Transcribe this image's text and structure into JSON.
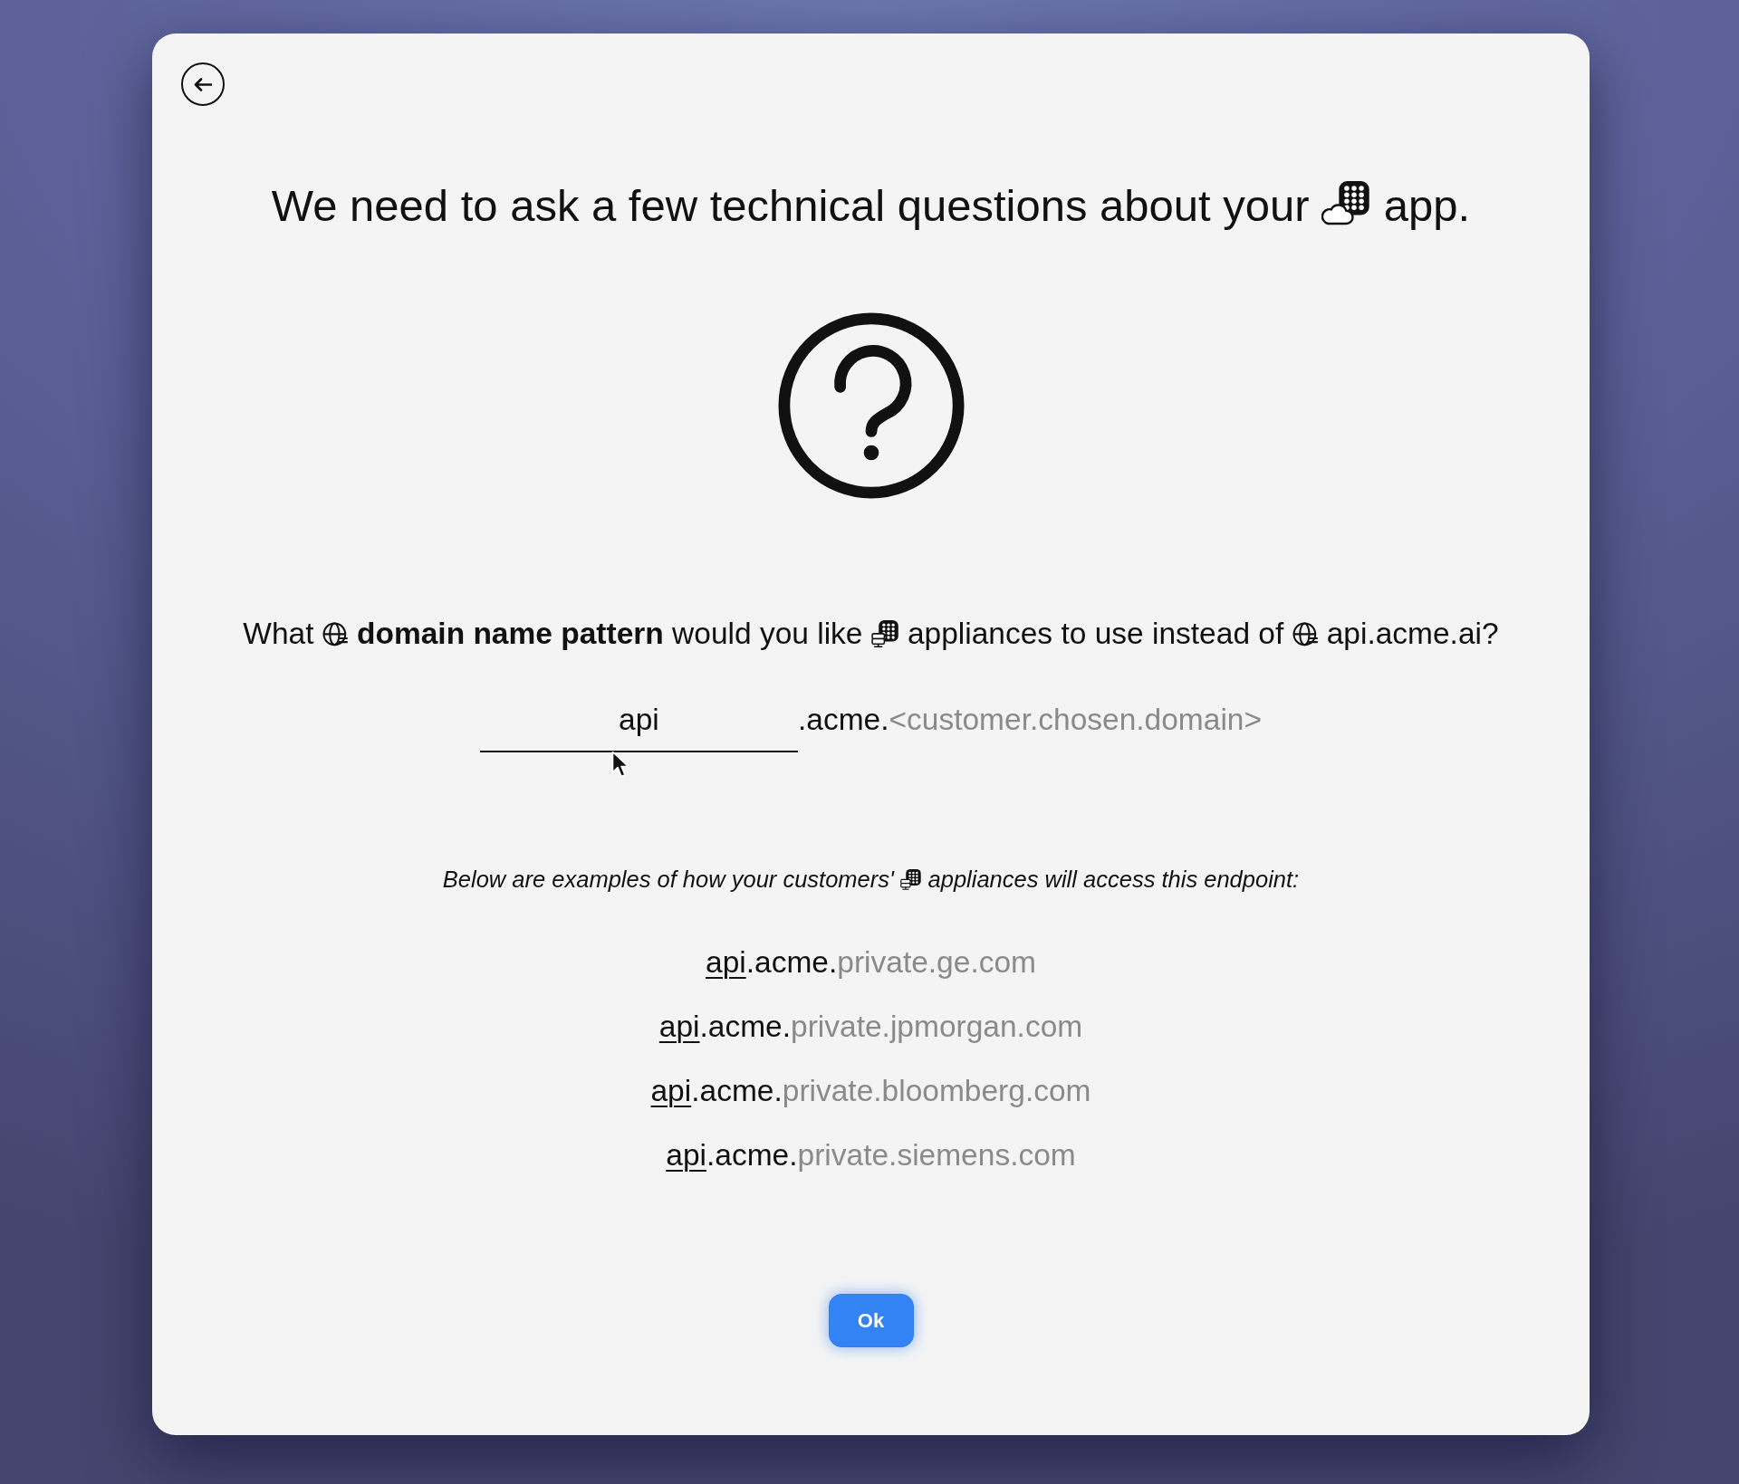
{
  "title": [
    {
      "kind": "text",
      "text": "We need to ask a few technical questions about your"
    },
    {
      "kind": "cloud-app"
    },
    {
      "kind": "text",
      "text": "app."
    }
  ],
  "question": [
    {
      "kind": "text",
      "text": "What"
    },
    {
      "kind": "globe"
    },
    {
      "kind": "text",
      "text": "**domain name pattern** would you like"
    },
    {
      "kind": "appliance"
    },
    {
      "kind": "text",
      "text": "appliances to use instead of"
    },
    {
      "kind": "globe"
    },
    {
      "kind": "text",
      "text": "api.acme.ai?"
    }
  ],
  "subdomain_field": {
    "value": "api",
    "suffix": ".acme.",
    "domain_hint": "<customer.chosen.domain>"
  },
  "examples_intro": [
    {
      "kind": "text",
      "text": "Below are examples of how your customers'"
    },
    {
      "kind": "appliance"
    },
    {
      "kind": "text",
      "text": "appliances will access this endpoint:"
    }
  ],
  "examples": [
    {
      "subdomain": "api",
      "suffix": ".acme.",
      "domain": "private.ge.com"
    },
    {
      "subdomain": "api",
      "suffix": ".acme.",
      "domain": "private.jpmorgan.com"
    },
    {
      "subdomain": "api",
      "suffix": ".acme.",
      "domain": "private.bloomberg.com"
    },
    {
      "subdomain": "api",
      "suffix": ".acme.",
      "domain": "private.siemens.com"
    }
  ],
  "ok_button": {
    "label": "Ok"
  }
}
